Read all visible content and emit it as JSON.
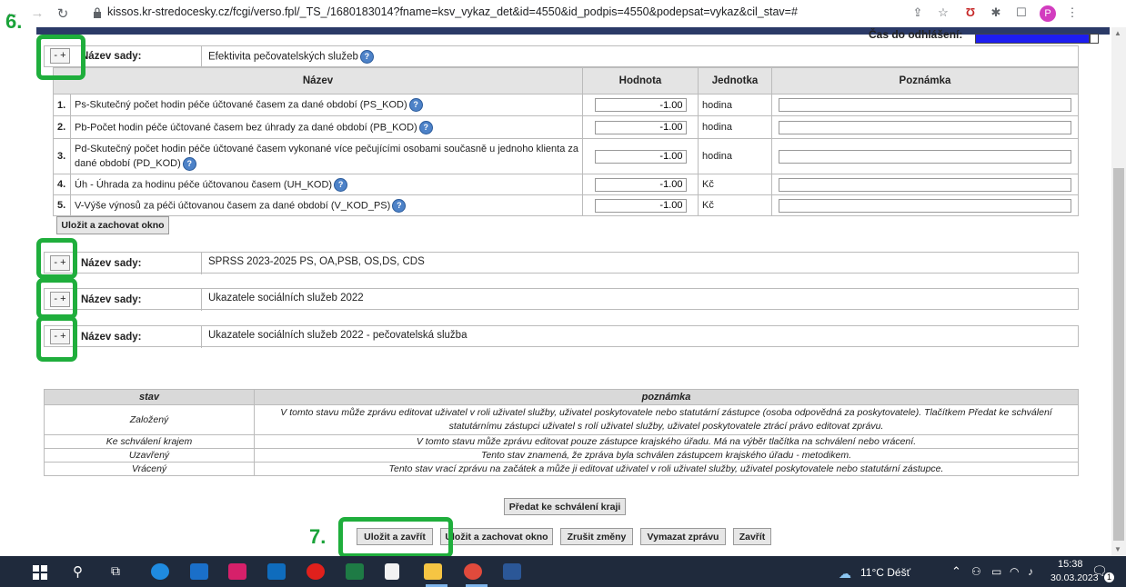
{
  "browser": {
    "url": "kissos.kr-stredocesky.cz/fcgi/verso.fpl/_TS_/1680183014?fname=ksv_vykaz_det&id=4550&id_podpis=4550&podepsat=vykaz&cil_stav=#",
    "profile_initial": "P"
  },
  "session": {
    "label": "Čas do odhlášení:",
    "remaining_fraction": 0.93
  },
  "steps": {
    "six": "6.",
    "seven": "7."
  },
  "sets": [
    {
      "toggle": "- +",
      "label": "Název sady:",
      "name": "Efektivita pečovatelských služeb"
    },
    {
      "toggle": "- +",
      "label": "Název sady:",
      "name": "SPRSS 2023-2025 PS, OA,PSB, OS,DS, CDS"
    },
    {
      "toggle": "- +",
      "label": "Název sady:",
      "name": "Ukazatele sociálních služeb 2022"
    },
    {
      "toggle": "- +",
      "label": "Název sady:",
      "name": "Ukazatele sociálních služeb 2022 - pečovatelská služba"
    }
  ],
  "table": {
    "headers": {
      "name": "Název",
      "value": "Hodnota",
      "unit": "Jednotka",
      "note": "Poznámka"
    },
    "rows": [
      {
        "num": "1.",
        "name": "Ps-Skutečný počet hodin péče účtované časem za dané období (PS_KOD)",
        "value": "-1.00",
        "unit": "hodina"
      },
      {
        "num": "2.",
        "name": "Pb-Počet hodin péče účtované časem bez úhrady za dané období (PB_KOD)",
        "value": "-1.00",
        "unit": "hodina"
      },
      {
        "num": "3.",
        "name": "Pd-Skutečný počet hodin péče účtované časem vykonané více pečujícími osobami současně u jednoho klienta za",
        "name2": "dané období (PD_KOD)",
        "value": "-1.00",
        "unit": "hodina"
      },
      {
        "num": "4.",
        "name": "Úh - Úhrada za hodinu péče účtovanou časem (UH_KOD)",
        "value": "-1.00",
        "unit": "Kč"
      },
      {
        "num": "5.",
        "name": "V-Výše výnosů za péči účtovanou časem za dané období (V_KOD_PS)",
        "value": "-1.00",
        "unit": "Kč"
      }
    ],
    "save_keep_label": "Uložit a zachovat okno"
  },
  "help_glyph": "?",
  "legend": {
    "headers": {
      "state": "stav",
      "note": "poznámka"
    },
    "rows": [
      {
        "state": "Založený",
        "line1": "V tomto stavu může zprávu editovat uživatel v roli uživatel služby, uživatel poskytovatele nebo statutární zástupce (osoba odpovědná za poskytovatele). Tlačítkem Předat ke schválení",
        "line2": "statutárnímu zástupci uživatel s rolí uživatel služby, uživatel poskytovatele ztrácí právo editovat zprávu."
      },
      {
        "state": "Ke schválení krajem",
        "line1": "V tomto stavu může zprávu editovat pouze zástupce krajského úřadu. Má na výběr tlačítka na schválení nebo vrácení."
      },
      {
        "state": "Uzavřený",
        "line1": "Tento stav znamená, že zpráva byla schválen zástupcem krajského úřadu - metodikem."
      },
      {
        "state": "Vrácený",
        "line1": "Tento stav vrací zprávu na začátek a může ji editovat uživatel v roli uživatel služby, uživatel poskytovatele nebo statutární zástupce."
      }
    ]
  },
  "buttons": {
    "submit": "Předat ke schválení kraji",
    "save_close": "Uložit a zavřít",
    "save_keep": "Uložit a zachovat okno",
    "discard": "Zrušit změny",
    "delete": "Vymazat zprávu",
    "close": "Zavřít"
  },
  "taskbar": {
    "weather": "11°C Déšť",
    "time": "15:38",
    "date": "30.03.2023",
    "notif_count": "1"
  },
  "colors": {
    "highlight": "#1fae3c",
    "header_bar": "#2b3a67",
    "session_bar": "#1d1df0"
  }
}
